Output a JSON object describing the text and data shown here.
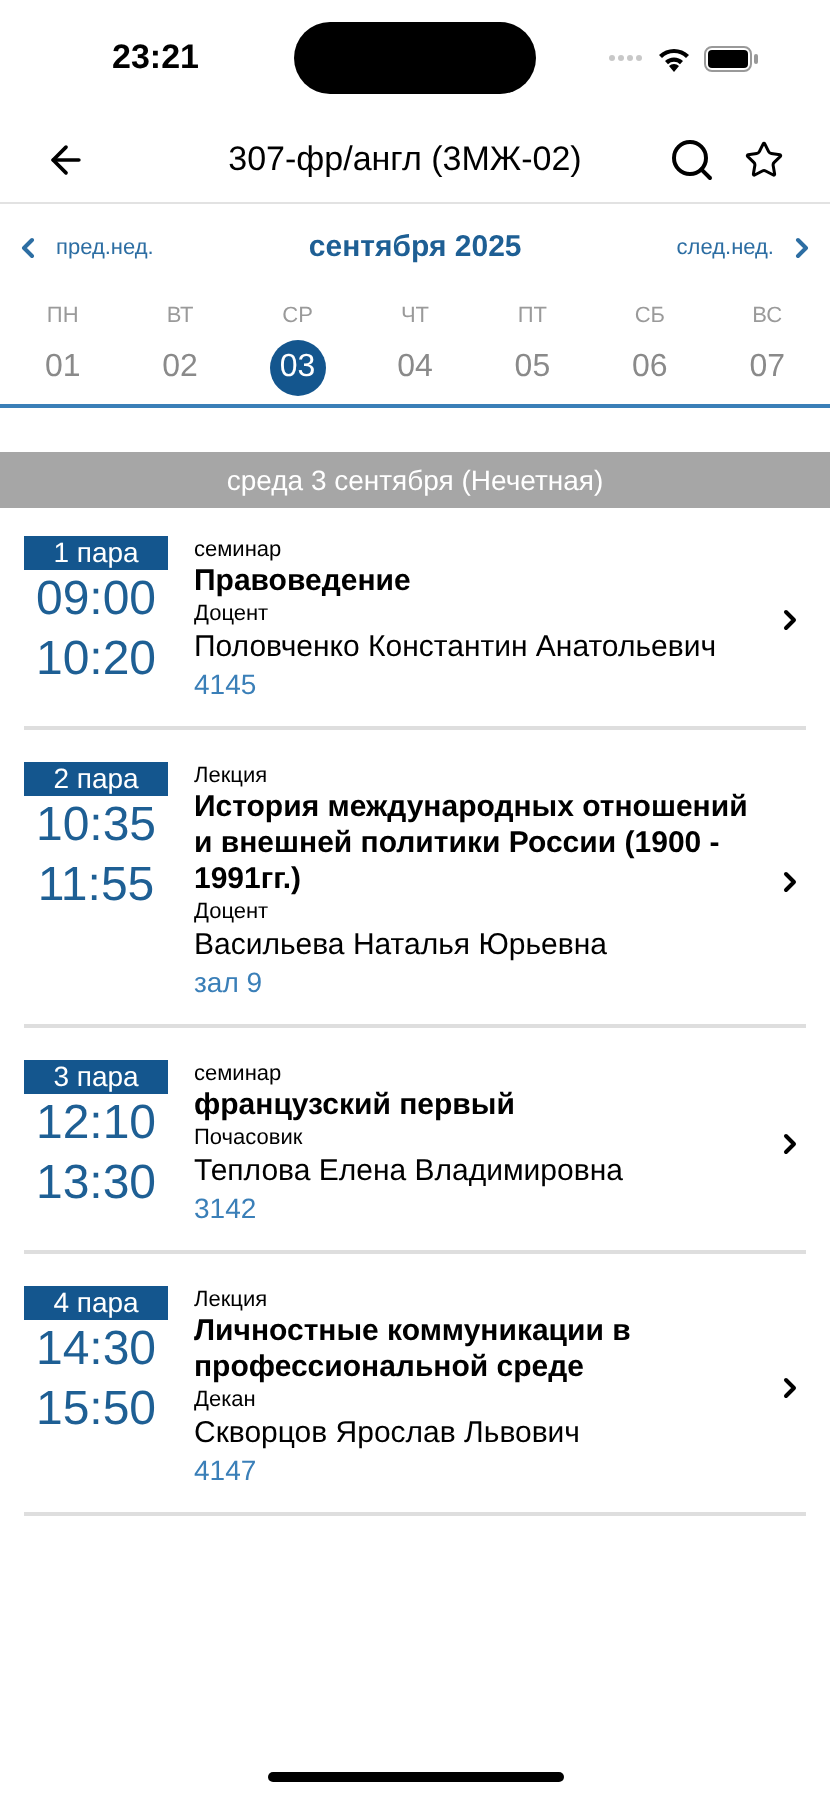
{
  "status_bar": {
    "time": "23:21"
  },
  "header": {
    "title": "307-фр/англ (3МЖ-02)"
  },
  "week_nav": {
    "prev": "пред.нед.",
    "month": "сентября 2025",
    "next": "след.нед."
  },
  "days": [
    {
      "weekday": "ПН",
      "date": "01",
      "selected": false
    },
    {
      "weekday": "ВТ",
      "date": "02",
      "selected": false
    },
    {
      "weekday": "СР",
      "date": "03",
      "selected": true
    },
    {
      "weekday": "ЧТ",
      "date": "04",
      "selected": false
    },
    {
      "weekday": "ПТ",
      "date": "05",
      "selected": false
    },
    {
      "weekday": "СБ",
      "date": "06",
      "selected": false
    },
    {
      "weekday": "ВС",
      "date": "07",
      "selected": false
    }
  ],
  "day_banner": "среда 3 сентября (Нечетная)",
  "lessons": [
    {
      "number": "1 пара",
      "start": "09:00",
      "end": "10:20",
      "type": "семинар",
      "subject": "Правоведение",
      "position": "Доцент",
      "teacher": "Половченко Константин Анатольевич",
      "room": "4145"
    },
    {
      "number": "2 пара",
      "start": "10:35",
      "end": "11:55",
      "type": "Лекция",
      "subject": "История международных отношений и внешней политики России (1900 - 1991гг.)",
      "position": "Доцент",
      "teacher": "Васильева Наталья Юрьевна",
      "room": "зал 9"
    },
    {
      "number": "3 пара",
      "start": "12:10",
      "end": "13:30",
      "type": "семинар",
      "subject": "французский первый",
      "position": "Почасовик",
      "teacher": "Теплова Елена Владимировна",
      "room": "3142"
    },
    {
      "number": "4 пара",
      "start": "14:30",
      "end": "15:50",
      "type": "Лекция",
      "subject": "Личностные коммуникации в профессиональной среде",
      "position": "Декан",
      "teacher": "Скворцов Ярослав Львович",
      "room": "4147"
    }
  ]
}
